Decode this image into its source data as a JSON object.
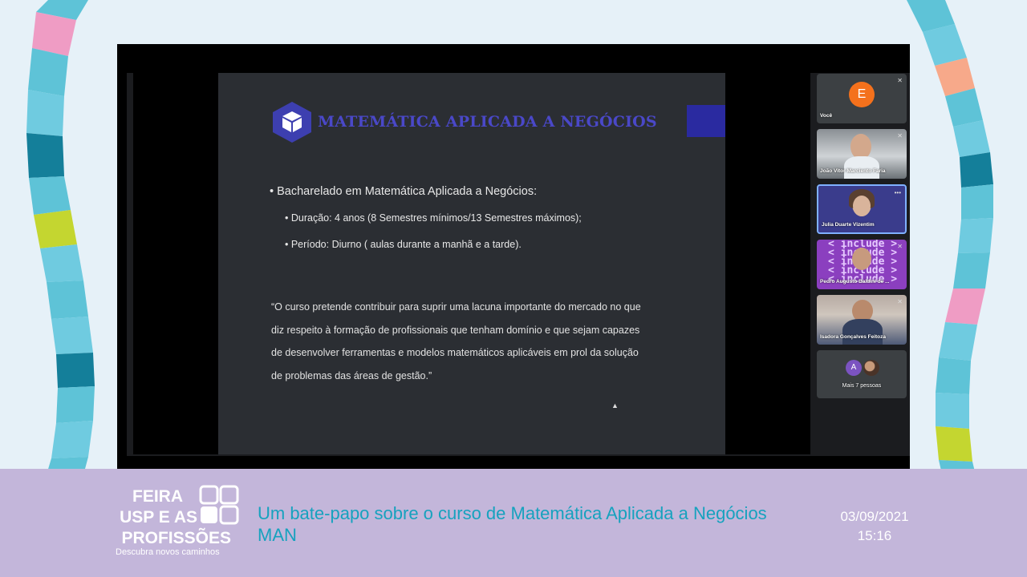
{
  "slide": {
    "title": "MATEMÁTICA APLICADA A NEGÓCIOS",
    "bullet_main": "• Bacharelado em Matemática Aplicada a Negócios:",
    "bullet_duration": "• Duração: 4 anos (8 Semestres mínimos/13 Semestres máximos);",
    "bullet_period": "• Período: Diurno ( aulas durante a manhã e a tarde).",
    "quote": "“O curso pretende contribuir para suprir uma lacuna importante do mercado no que diz respeito à formação de profissionais que tenham domínio e que sejam capazes de desenvolver ferramentas e modelos matemáticos aplicáveis em prol da solução de problemas das áreas de gestão.”"
  },
  "participants": {
    "you": {
      "initial": "E",
      "label": "Você"
    },
    "joao": {
      "label": "João Vitor Marciento Faria"
    },
    "julia": {
      "label": "Julia Duarte Vizentim"
    },
    "pedro": {
      "label": "Pedro Augusto Baldini de ...",
      "background_text": "< include >"
    },
    "isadora": {
      "label": "Isadora Gonçalves Feitoza"
    },
    "more": {
      "initial": "A",
      "label": "Mais 7 pessoas"
    }
  },
  "banner": {
    "fair_line1": "FEIRA",
    "fair_line2": "USP E AS",
    "fair_line3": "PROFISSÕES",
    "tagline": "Descubra novos caminhos",
    "event_title_line1": "Um bate-papo sobre o curso de Matemática Aplicada a Negócios",
    "event_title_line2": "MAN",
    "date": "03/09/2021",
    "time": "15:16"
  },
  "colors": {
    "slide_title": "#4a48c8",
    "event_title": "#16a2be",
    "banner_bg": "#c3b6da",
    "you_avatar": "#f4711c"
  }
}
